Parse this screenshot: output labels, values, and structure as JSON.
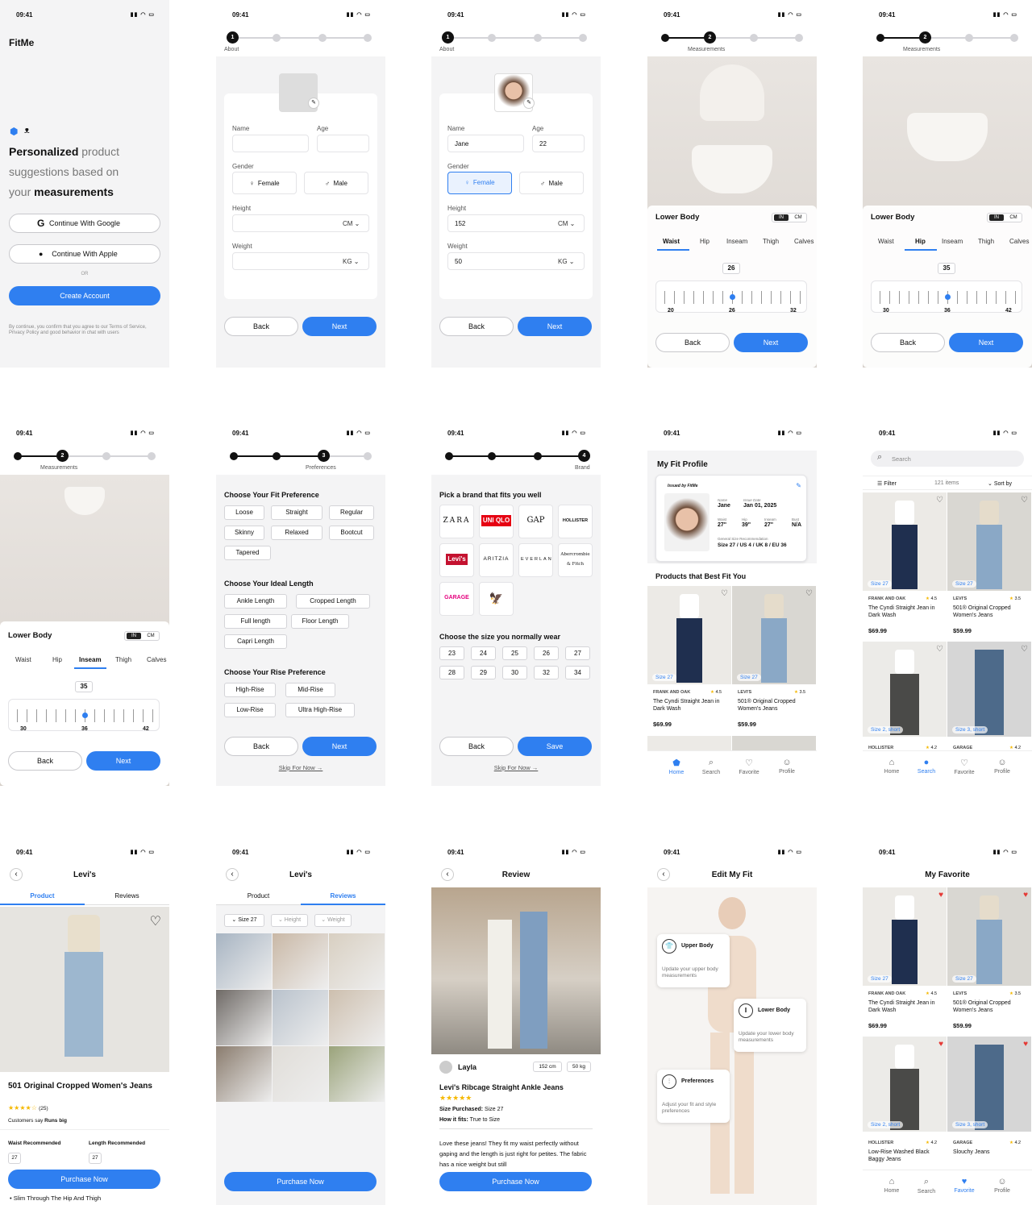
{
  "status_time": "09:41",
  "status_icons": "▮▮ ◠ ▭",
  "s1": {
    "app": "FitMe",
    "h_bold1": "Personalized",
    "h_rest1": " product",
    "h_line2": "suggestions based on",
    "h_line3a": "your ",
    "h_bold3": "measurements",
    "google": "Continue With Google",
    "apple": "Continue With Apple",
    "or": "OR",
    "create": "Create Account",
    "legal": "By continue, you confirm that you agree to our Terms of Service, Privacy Policy and good behavior in chat with users"
  },
  "steps": {
    "about": "About",
    "measure": "Measurements",
    "pref": "Preferences",
    "brand": "Brand",
    "n1": "1",
    "n2": "2",
    "n3": "3",
    "n4": "4"
  },
  "form": {
    "name": "Name",
    "age": "Age",
    "gender": "Gender",
    "female": "Female",
    "male": "Male",
    "height": "Height",
    "weight": "Weight",
    "cm": "CM",
    "kg": "KG",
    "name_val": "Jane",
    "age_val": "22",
    "height_val": "152",
    "weight_val": "50"
  },
  "btn": {
    "back": "Back",
    "next": "Next",
    "save": "Save",
    "skip": "Skip For Now →",
    "purchase": "Purchase Now"
  },
  "lower": {
    "title": "Lower Body",
    "in": "IN",
    "cm": "CM",
    "tabs": [
      "Waist",
      "Hip",
      "Inseam",
      "Thigh",
      "Calves"
    ],
    "w_val": "26",
    "w_ticks": [
      "20",
      "26",
      "32"
    ],
    "h_val": "35",
    "h_ticks": [
      "30",
      "36",
      "42"
    ],
    "i_val": "35",
    "i_ticks": [
      "30",
      "36",
      "42"
    ]
  },
  "prefs": {
    "fit_h": "Choose Your Fit Preference",
    "fit": [
      "Loose",
      "Straight",
      "Regular",
      "Skinny",
      "Relaxed",
      "Bootcut",
      "Tapered"
    ],
    "len_h": "Choose Your Ideal Length",
    "len": [
      "Ankle Length",
      "Cropped Length",
      "Full length",
      "Floor Length",
      "Capri Length"
    ],
    "rise_h": "Choose Your Rise Preference",
    "rise": [
      "High-Rise",
      "Mid-Rise",
      "Low-Rise",
      "Ultra High-Rise"
    ]
  },
  "brands": {
    "h": "Pick a brand that fits you well",
    "list": [
      "ZARA",
      "UNI QLO",
      "GAP",
      "HOLLISTER",
      "Levi's",
      "ARITZIA",
      "EVERLANE",
      "Abercrombie & Fitch",
      "GARAGE",
      "🦅"
    ],
    "size_h": "Choose the size you normally wear",
    "sizes": [
      "23",
      "24",
      "25",
      "26",
      "27",
      "28",
      "29",
      "30",
      "32",
      "34"
    ]
  },
  "profile": {
    "title": "My Fit Profile",
    "issued": "Issued by FitMe",
    "name_l": "Name",
    "name": "Jane",
    "date_l": "Issue Date",
    "date": "Jan 01, 2025",
    "waist_l": "Waist",
    "waist": "27\"",
    "hip_l": "Hip",
    "hip": "39\"",
    "inseam_l": "Inseam",
    "inseam": "27\"",
    "bust_l": "Bust",
    "bust": "N/A",
    "rec_l": "General Size Recommendation",
    "rec": "Size 27 / US 4 / UK 8 / EU 36",
    "best": "Products that Best Fit You"
  },
  "products": [
    {
      "brand": "FRANK AND OAK",
      "rate": "4.5",
      "name": "The Cyndi Straight Jean in Dark Wash",
      "price": "$69.99",
      "size": "Size 27"
    },
    {
      "brand": "LEVI'S",
      "rate": "3.5",
      "name": "501® Original Cropped Women's Jeans",
      "price": "$59.99",
      "size": "Size 27"
    },
    {
      "brand": "HOLLISTER",
      "rate": "4.2",
      "name": "Low-Rise Washed Black Baggy Jeans",
      "price": "",
      "size": "Size 2, short"
    },
    {
      "brand": "GARAGE",
      "rate": "4.2",
      "name": "Slouchy Jeans",
      "price": "",
      "size": "Size 3, short"
    }
  ],
  "nav": [
    "Home",
    "Search",
    "Favorite",
    "Profile"
  ],
  "search": {
    "ph": "Search",
    "filter": "Filter",
    "count": "121 items",
    "sort": "Sort by"
  },
  "pdp": {
    "title": "Levi's",
    "tab1": "Product",
    "tab2": "Reviews",
    "name": "501 Original Cropped Women's Jeans",
    "reviews": "(25)",
    "say": "Customers say ",
    "say_b": "Runs big",
    "waist_l": "Waist Recommended",
    "len_l": "Length Recommended",
    "w": "27",
    "l": "27",
    "bullet": "Slim Through The Hip And Thigh"
  },
  "filters": [
    "Size 27",
    "Height",
    "Weight"
  ],
  "review": {
    "title": "Review",
    "user": "Layla",
    "h": "152 cm",
    "w": "50 kg",
    "prod": "Levi's Ribcage Straight Ankle Jeans",
    "sp_l": "Size Purchased:",
    "sp": " Size 27",
    "hf_l": "How it fits:",
    "hf": " True to Size",
    "text": "Love these jeans! They fit my waist perfectly without gaping and the length is just right for petites. The fabric has a nice weight but still"
  },
  "edit": {
    "title": "Edit My Fit",
    "ub": "Upper Body",
    "ub_d": "Update your upper body measurements",
    "lb": "Lower Body",
    "lb_d": "Update your lower body measurements",
    "pr": "Preferences",
    "pr_d": "Adjust your fit and style preferences"
  },
  "fav": {
    "title": "My Favorite"
  },
  "colors": {
    "accent": "#2f7ff0"
  }
}
